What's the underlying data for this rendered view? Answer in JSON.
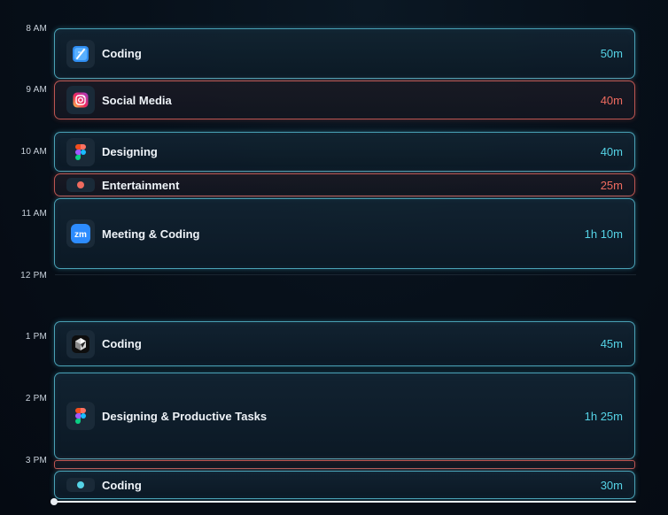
{
  "time_labels": [
    "8 AM",
    "9 AM",
    "10 AM",
    "11 AM",
    "12 PM",
    "1 PM",
    "2 PM",
    "3 PM"
  ],
  "blocks": [
    {
      "label": "Coding",
      "duration": "50m",
      "icon": "xcode-icon",
      "color": "#55d3e6"
    },
    {
      "label": "Social Media",
      "duration": "40m",
      "icon": "instagram-icon",
      "color": "#ef6b5f"
    },
    {
      "label": "Designing",
      "duration": "40m",
      "icon": "figma-icon",
      "color": "#55d3e6"
    },
    {
      "label": "Entertainment",
      "duration": "25m",
      "icon": "dot-icon",
      "color": "#ef6b5f"
    },
    {
      "label": "Meeting & Coding",
      "duration": "1h 10m",
      "icon": "zoom-icon",
      "color": "#55d3e6"
    },
    {
      "label": "Coding",
      "duration": "45m",
      "icon": "cursor-app-icon",
      "color": "#55d3e6"
    },
    {
      "label": "Designing & Productive Tasks",
      "duration": "1h 25m",
      "icon": "figma-icon",
      "color": "#55d3e6"
    },
    {
      "label": "",
      "duration": "",
      "icon": "",
      "color": "#ef6b5f"
    },
    {
      "label": "Coding",
      "duration": "30m",
      "icon": "dot-icon",
      "color": "#55d3e6"
    }
  ],
  "colors": {
    "productive": "#55d3e6",
    "distracting": "#ef6b5f",
    "background": "#050a12"
  }
}
